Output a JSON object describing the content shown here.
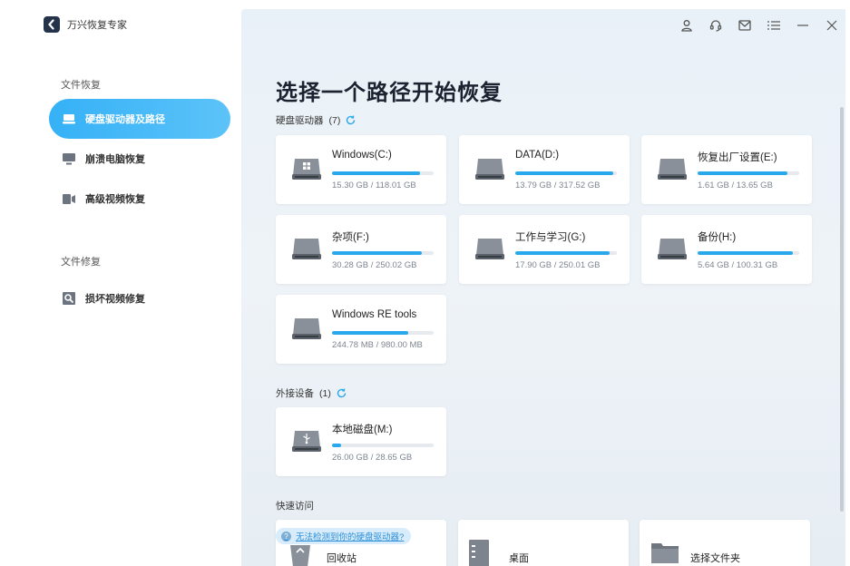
{
  "app": {
    "title": "万兴恢复专家"
  },
  "sidebar": {
    "section_recover": "文件恢复",
    "section_repair": "文件修复",
    "items": [
      {
        "label": "硬盘驱动器及路径",
        "icon": "hard-drive-icon",
        "active": true
      },
      {
        "label": "崩溃电脑恢复",
        "icon": "monitor-icon",
        "active": false
      },
      {
        "label": "高级视频恢复",
        "icon": "video-camera-icon",
        "active": false
      },
      {
        "label": "损坏视频修复",
        "icon": "video-repair-icon",
        "active": false
      }
    ]
  },
  "titlebar": {
    "icons": [
      "user-icon",
      "headset-icon",
      "mail-icon",
      "menu-icon",
      "minimize-icon",
      "close-icon"
    ]
  },
  "main": {
    "title": "选择一个路径开始恢复",
    "hard_drives_label": "硬盘驱动器",
    "hard_drives_count": "(7)",
    "external_label": "外接设备",
    "external_count": "(1)",
    "quick_access_label": "快速访问",
    "tip": "无法检测到你的硬盘驱动器?"
  },
  "drives": [
    {
      "name": "Windows(C:)",
      "size": "15.30 GB / 118.01 GB",
      "used": 0.87,
      "icon": "windows-drive-icon"
    },
    {
      "name": "DATA(D:)",
      "size": "13.79 GB / 317.52 GB",
      "used": 0.96,
      "icon": "hard-drive-icon"
    },
    {
      "name": "恢复出厂设置(E:)",
      "size": "1.61 GB / 13.65 GB",
      "used": 0.88,
      "icon": "hard-drive-icon"
    },
    {
      "name": "杂项(F:)",
      "size": "30.28 GB / 250.02 GB",
      "used": 0.88,
      "icon": "hard-drive-icon"
    },
    {
      "name": "工作与学习(G:)",
      "size": "17.90 GB / 250.01 GB",
      "used": 0.93,
      "icon": "hard-drive-icon"
    },
    {
      "name": "备份(H:)",
      "size": "5.64 GB / 100.31 GB",
      "used": 0.94,
      "icon": "hard-drive-icon"
    },
    {
      "name": "Windows RE tools",
      "size": "244.78 MB / 980.00 MB",
      "used": 0.75,
      "icon": "hard-drive-icon"
    }
  ],
  "external": [
    {
      "name": "本地磁盘(M:)",
      "size": "26.00 GB / 28.65 GB",
      "used": 0.09,
      "icon": "usb-drive-icon"
    }
  ],
  "quick_access": [
    {
      "label": "回收站",
      "icon": "recycle-bin-icon"
    },
    {
      "label": "桌面",
      "icon": "desktop-icon"
    },
    {
      "label": "选择文件夹",
      "icon": "folder-icon"
    }
  ],
  "colors": {
    "accent": "#2aa8ec",
    "active_nav": "#35b1f7"
  }
}
